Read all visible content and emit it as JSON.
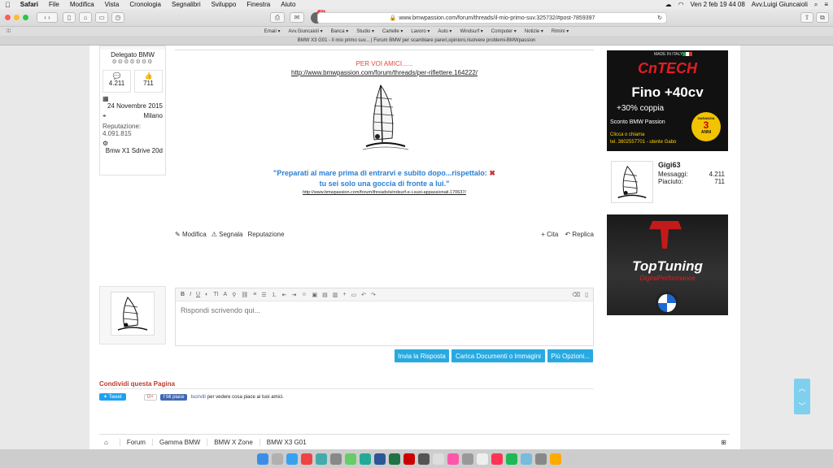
{
  "menubar": {
    "app": "Safari",
    "items": [
      "File",
      "Modifica",
      "Vista",
      "Cronologia",
      "Segnalibri",
      "Sviluppo",
      "Finestra",
      "Aiuto"
    ],
    "clock": "Ven 2 feb  19 44 08",
    "user": "Avv.Luigi Giuncaioli"
  },
  "toolbar": {
    "url": "www.bmwpassion.com/forum/threads/il-mio-primo-suv.325732/#post-7859397",
    "badge": "10"
  },
  "favorites": [
    "Email ▾",
    "Avv.Giuncaioli ▾",
    "Banca ▾",
    "Studio ▾",
    "Cartelle ▾",
    "Lavoro ▾",
    "Auto ▾",
    "Windsurf ▾",
    "Computer ▾",
    "Notizie ▾",
    "Rimini ▾"
  ],
  "tab": {
    "title": "BMW X3 G01 - Il mio primo suv... | Forum BMW per scambiare pareri,opinioni,risolvere problemi-BMWpassion"
  },
  "profile": {
    "role": "Delegato BMW",
    "messages_count": "4.211",
    "likes_count": "711",
    "joined": "24 Novembre 2015",
    "location": "Milano",
    "reputation_label": "Reputazione:",
    "reputation_value": "4.091.815",
    "car": "Bmw X1 Sdrive 20d"
  },
  "post": {
    "heading": "PER VOI AMICI......",
    "link1": "http://www.bmwpassion.com/forum/threads/per-riflettere.164222/",
    "quote_line1": "\"Preparati al mare prima di entrarvi e subito dopo...rispettalo:",
    "quote_line2": "tu sei solo una goccia di fronte a lui.\"",
    "link2": "http://www.bmwpassion.com/forum/threads/windsurf-e-i-suoi-appassionati.170637/"
  },
  "actions": {
    "modifica": "Modifica",
    "segnala": "Segnala",
    "reputazione": "Reputazione",
    "cita": "+ Cita",
    "replica": "Replica"
  },
  "editor": {
    "placeholder": "Rispondi scrivendo qui...",
    "send": "Invia la Risposta",
    "upload": "Carica Documenti o Immagini",
    "more": "Più Opzioni..."
  },
  "share": {
    "title": "Condividi questa Pagina",
    "tweet": "Tweet",
    "gplus": "G+",
    "fb_like": "Mi piace",
    "fb_text_link": "Iscriviti",
    "fb_text": "per vedere cosa piace ai tuoi amici."
  },
  "sidebar": {
    "ad1": {
      "made_in": "MADE IN ITALY",
      "brand": "CnTECH",
      "headline": "Fino +40cv",
      "sub": "+30% coppia",
      "discount": "Sconto BMW Passion",
      "call": "Clicca o chiama",
      "phone": "tel. 3802557701 - utente Gabo",
      "garanzia": "GARANZIA",
      "years": "3",
      "anni": "ANNI"
    },
    "user": {
      "name": "Gigi63",
      "messages_label": "Messaggi:",
      "messages_value": "4.211",
      "likes_label": "Piaciuto:",
      "likes_value": "711"
    },
    "ad2": {
      "brand": "TopTuning",
      "sub": "DigitalPerformance"
    }
  },
  "breadcrumb": [
    "Forum",
    "Gamma BMW",
    "BMW X Zone",
    "BMW X3 G01"
  ],
  "colors": {
    "accent_blue": "#27a9e1",
    "red_heading": "#e04a3a",
    "share_red": "#c0392b",
    "quote_blue": "#2a7fd4"
  }
}
